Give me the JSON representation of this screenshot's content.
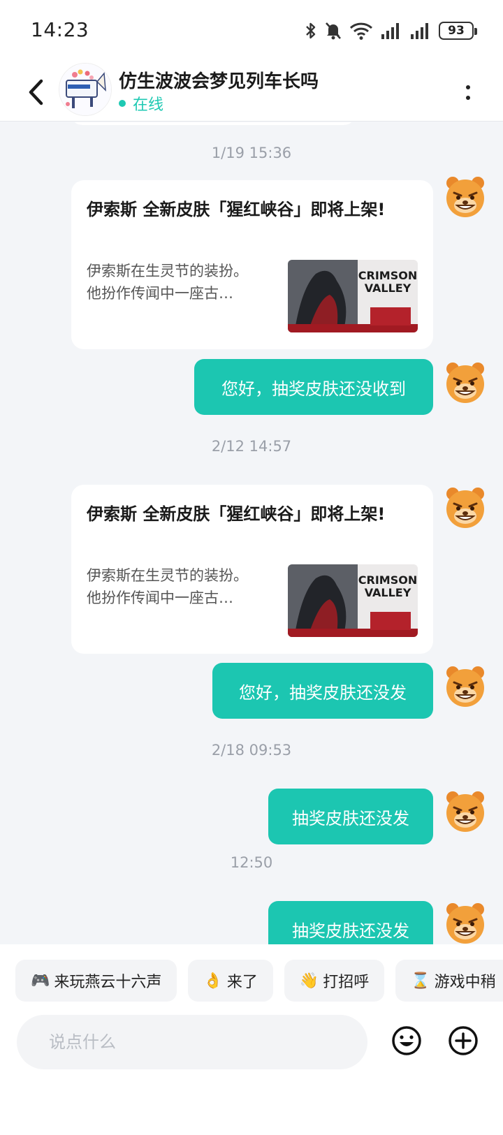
{
  "status_bar": {
    "time": "14:23",
    "battery": "93",
    "icons": [
      "bluetooth-icon",
      "mute-icon",
      "wifi-icon",
      "signal-icon",
      "signal-icon",
      "battery-icon"
    ]
  },
  "header": {
    "title": "仿生波波会梦见列车长吗",
    "status": "在线",
    "back_icon": "chevron-left-icon",
    "more_icon": "more-vertical-icon"
  },
  "messages": [
    {
      "type": "timestamp",
      "text": "1/19  15:36"
    },
    {
      "type": "card",
      "sender": "bot",
      "title": "伊索斯 全新皮肤「猩红峡谷」即将上架!",
      "desc": "伊索斯在生灵节的装扮。他扮作传闻中一座古…",
      "thumb_text": [
        "CRIMSON",
        "VALLEY"
      ]
    },
    {
      "type": "text",
      "sender": "self",
      "text": "您好，抽奖皮肤还没收到"
    },
    {
      "type": "timestamp",
      "text": "2/12  14:57"
    },
    {
      "type": "card",
      "sender": "bot",
      "title": "伊索斯 全新皮肤「猩红峡谷」即将上架!",
      "desc": "伊索斯在生灵节的装扮。他扮作传闻中一座古…",
      "thumb_text": [
        "CRIMSON",
        "VALLEY"
      ]
    },
    {
      "type": "text",
      "sender": "self",
      "text": "您好，抽奖皮肤还没发"
    },
    {
      "type": "timestamp",
      "text": "2/18  09:53"
    },
    {
      "type": "text",
      "sender": "self",
      "text": "抽奖皮肤还没发"
    },
    {
      "type": "timestamp",
      "text": "12:50"
    },
    {
      "type": "text",
      "sender": "self",
      "text": "抽奖皮肤还没发"
    }
  ],
  "quick_replies": [
    {
      "emoji": "🎮",
      "label": "来玩燕云十六声"
    },
    {
      "emoji": "👌",
      "label": "来了"
    },
    {
      "emoji": "👋",
      "label": "打招呼"
    },
    {
      "emoji": "⌛",
      "label": "游戏中稍"
    }
  ],
  "input": {
    "placeholder": "说点什么",
    "emoji_icon": "emoji-smile-icon",
    "plus_icon": "plus-circle-icon"
  },
  "colors": {
    "accent": "#1cc6b1",
    "background": "#f3f5f8",
    "card": "#ffffff"
  }
}
